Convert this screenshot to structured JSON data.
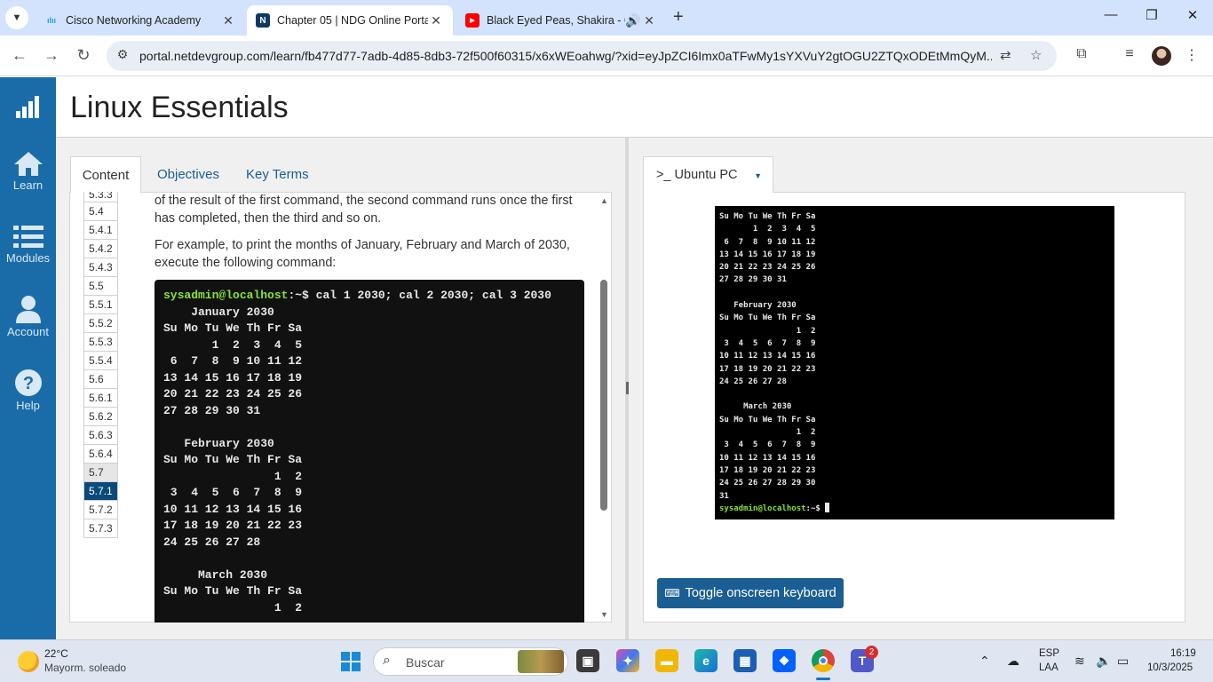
{
  "browser": {
    "tabs": [
      {
        "title": "Cisco Networking Academy",
        "favicon": "cisco-logo-icon"
      },
      {
        "title": "Chapter 05 | NDG Online Portal",
        "favicon": "ndg-logo-icon"
      },
      {
        "title": "Black Eyed Peas, Shakira - G",
        "favicon": "youtube-icon"
      }
    ],
    "url": "portal.netdevgroup.com/learn/fb477d77-7adb-4d85-8db3-72f500f60315/x6xWEoahwg/?xid=eyJpZCI6Imx0aTFwMy1sYXVuY2gtOGU2ZTQxODEtMmQyM..."
  },
  "sidebar": {
    "items": [
      {
        "label": "",
        "icon": "cisco-bars-icon"
      },
      {
        "label": "Learn",
        "icon": "home-icon"
      },
      {
        "label": "Modules",
        "icon": "list-icon"
      },
      {
        "label": "Account",
        "icon": "person-icon"
      },
      {
        "label": "Help",
        "icon": "question-icon"
      }
    ]
  },
  "page": {
    "title": "Linux Essentials"
  },
  "content_tabs": {
    "content": "Content",
    "objectives": "Objectives",
    "key_terms": "Key Terms"
  },
  "toc": [
    "5.3.3",
    "5.4",
    "5.4.1",
    "5.4.2",
    "5.4.3",
    "5.5",
    "5.5.1",
    "5.5.2",
    "5.5.3",
    "5.5.4",
    "5.6",
    "5.6.1",
    "5.6.2",
    "5.6.3",
    "5.6.4",
    "5.7",
    "5.7.1",
    "5.7.2",
    "5.7.3"
  ],
  "lesson": {
    "p1_line1": "of the result of the first command, the second command runs once the first",
    "p1_line2": "has completed, then the third and so on.",
    "p2_line1": "For example, to print the months of January, February and March of 2030,",
    "p2_line2": "execute the following command:"
  },
  "example_terminal": {
    "prompt": "sysadmin@localhost",
    "prompt_suffix": ":~$ ",
    "command": "cal 1 2030; cal 2 2030; cal 3 2030",
    "output": "    January 2030\nSu Mo Tu We Th Fr Sa\n       1  2  3  4  5\n 6  7  8  9 10 11 12\n13 14 15 16 17 18 19\n20 21 22 23 24 25 26\n27 28 29 30 31\n\n   February 2030\nSu Mo Tu We Th Fr Sa\n                1  2\n 3  4  5  6  7  8  9\n10 11 12 13 14 15 16\n17 18 19 20 21 22 23\n24 25 26 27 28\n\n     March 2030\nSu Mo Tu We Th Fr Sa\n                1  2"
  },
  "vm": {
    "tab_label": ">_ Ubuntu PC",
    "screen_output": "Su Mo Tu We Th Fr Sa\n       1  2  3  4  5\n 6  7  8  9 10 11 12\n13 14 15 16 17 18 19\n20 21 22 23 24 25 26\n27 28 29 30 31\n\n   February 2030\nSu Mo Tu We Th Fr Sa\n                1  2\n 3  4  5  6  7  8  9\n10 11 12 13 14 15 16\n17 18 19 20 21 22 23\n24 25 26 27 28\n\n     March 2030\nSu Mo Tu We Th Fr Sa\n                1  2\n 3  4  5  6  7  8  9\n10 11 12 13 14 15 16\n17 18 19 20 21 22 23\n24 25 26 27 28 29 30\n31",
    "prompt": "sysadmin@localhost",
    "prompt_suffix": ":~$ ",
    "keyboard_button": "Toggle onscreen keyboard"
  },
  "taskbar": {
    "weather_temp": "22°C",
    "weather_desc": "Mayorm. soleado",
    "search_placeholder": "Buscar",
    "teams_badge": "2",
    "lang_1": "ESP",
    "lang_2": "LAA",
    "time": "16:19",
    "date": "10/3/2025"
  },
  "colors": {
    "sidebar": "#1a6ca8",
    "active_toc": "#0b4a7a",
    "button": "#1a5e93",
    "terminal_prompt": "#8ae234"
  }
}
